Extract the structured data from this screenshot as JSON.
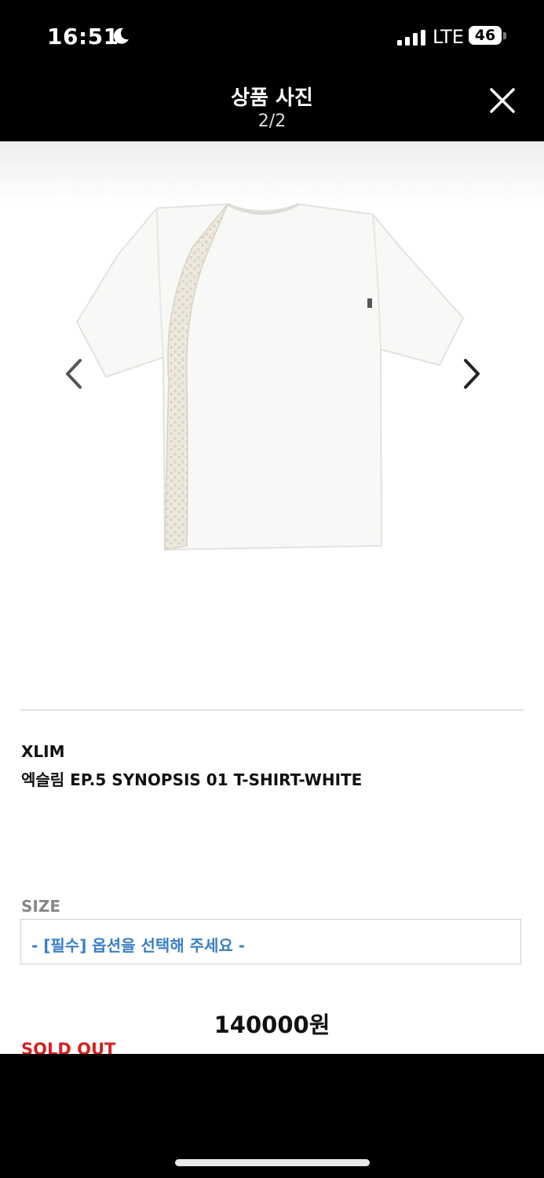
{
  "status_bar": {
    "time": "16:51",
    "network": "LTE",
    "battery": "46"
  },
  "header": {
    "title": "상품 사진",
    "counter": "2/2"
  },
  "product": {
    "brand": "XLIM",
    "name": "엑슬림 EP.5 SYNOPSIS 01 T-SHIRT-WHITE",
    "size_label": "SIZE",
    "size_select_value": "- [필수] 옵션을 선택해 주세요 -",
    "price": "140000원",
    "status": "SOLD OUT"
  },
  "colors": {
    "select_text": "#3a7fc4",
    "sold_out": "#d42020"
  },
  "icons": [
    "moon-icon",
    "signal-icon",
    "battery-icon",
    "close-icon",
    "chevron-left-icon",
    "chevron-right-icon"
  ]
}
